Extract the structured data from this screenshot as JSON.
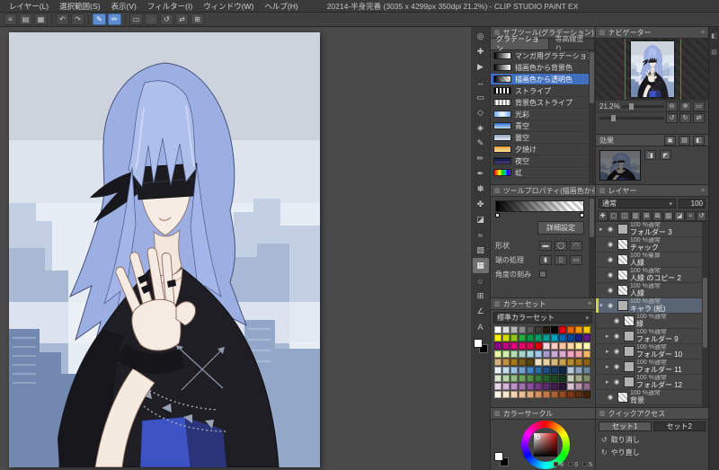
{
  "window": {
    "title": "20214-半身完番 (3035 x 4299px 350dpi 21.2%) - CLIP STUDIO PAINT EX",
    "menus": [
      "レイヤー(L)",
      "選択範囲(S)",
      "表示(V)",
      "フィルター(I)",
      "ウィンドウ(W)",
      "ヘルプ(H)"
    ]
  },
  "toolbar": {
    "buttons": [
      {
        "name": "main-menu-button",
        "glyph": "≡",
        "active": false
      },
      {
        "name": "new-canvas-button",
        "glyph": "▤",
        "active": false
      },
      {
        "name": "save-button",
        "glyph": "▦",
        "active": false
      },
      {
        "name": "undo-button",
        "glyph": "↶",
        "active": false
      },
      {
        "name": "redo-button",
        "glyph": "↷",
        "active": false
      },
      {
        "name": "snap-ruler-toggle",
        "glyph": "✎",
        "active": true
      },
      {
        "name": "snap-guide-toggle",
        "glyph": "✏",
        "active": true
      },
      {
        "name": "select-button",
        "glyph": "▭",
        "active": false
      },
      {
        "name": "deselect-button",
        "glyph": "◌",
        "active": false
      },
      {
        "name": "rotate-view-button",
        "glyph": "↺",
        "active": false
      },
      {
        "name": "flip-view-button",
        "glyph": "⇄",
        "active": false
      },
      {
        "name": "grid-button",
        "glyph": "⊞",
        "active": false
      }
    ]
  },
  "toolbox": {
    "tools": [
      {
        "name": "zoom-tool",
        "glyph": "◎",
        "selected": false
      },
      {
        "name": "move-tool",
        "glyph": "✚",
        "selected": false
      },
      {
        "name": "operation-tool",
        "glyph": "▶",
        "selected": false
      },
      {
        "name": "layer-move-tool",
        "glyph": "↔",
        "selected": false
      },
      {
        "name": "selection-tool",
        "glyph": "▭",
        "selected": false
      },
      {
        "name": "auto-select-tool",
        "glyph": "◇",
        "selected": false
      },
      {
        "name": "eyedropper-tool",
        "glyph": "◈",
        "selected": false
      },
      {
        "name": "pen-tool",
        "glyph": "✎",
        "selected": false
      },
      {
        "name": "pencil-tool",
        "glyph": "✏",
        "selected": false
      },
      {
        "name": "brush-tool",
        "glyph": "✒",
        "selected": false
      },
      {
        "name": "airbrush-tool",
        "glyph": "✽",
        "selected": false
      },
      {
        "name": "decoration-tool",
        "glyph": "✤",
        "selected": false
      },
      {
        "name": "eraser-tool",
        "glyph": "◪",
        "selected": false
      },
      {
        "name": "blend-tool",
        "glyph": "≈",
        "selected": false
      },
      {
        "name": "fill-tool",
        "glyph": "▧",
        "selected": false
      },
      {
        "name": "gradient-tool",
        "glyph": "▦",
        "selected": true
      },
      {
        "name": "figure-tool",
        "glyph": "○",
        "selected": false
      },
      {
        "name": "frame-border-tool",
        "glyph": "⊞",
        "selected": false
      },
      {
        "name": "ruler-tool",
        "glyph": "∠",
        "selected": false
      },
      {
        "name": "text-tool",
        "glyph": "A",
        "selected": false
      }
    ],
    "foreground_color": "#ffffff",
    "background_color": "#000000"
  },
  "subtool": {
    "title": "サブツール(グラデーション)",
    "tabs": [
      "グラデーション",
      "等高線塗り"
    ],
    "items": [
      {
        "label": "マンガ用グラデーション",
        "icon": "manga-gradient",
        "selected": false
      },
      {
        "label": "描画色から背景色",
        "icon": "fg-to-bg",
        "selected": false
      },
      {
        "label": "描画色から透明色",
        "icon": "fg-to-transparent",
        "selected": true
      },
      {
        "label": "ストライプ",
        "icon": "stripe",
        "selected": false
      },
      {
        "label": "背景色ストライプ",
        "icon": "bg-stripe",
        "selected": false
      },
      {
        "label": "光彩",
        "icon": "glow",
        "selected": false
      },
      {
        "label": "青空",
        "icon": "blue-sky",
        "selected": false
      },
      {
        "label": "曇空",
        "icon": "cloudy-sky",
        "selected": false
      },
      {
        "label": "夕焼け",
        "icon": "sunset",
        "selected": false
      },
      {
        "label": "夜空",
        "icon": "night-sky",
        "selected": false
      },
      {
        "label": "虹",
        "icon": "rainbow",
        "selected": false
      }
    ]
  },
  "tool_property": {
    "title": "ツールプロパティ(描画色から透明色)",
    "detail_button": "詳細設定",
    "rows": [
      {
        "label": "形状",
        "type": "icons",
        "icons": [
          "▬",
          "◯",
          "◠"
        ]
      },
      {
        "label": "端の処理",
        "type": "icons",
        "icons": [
          "▮",
          "▯",
          "▭"
        ]
      },
      {
        "label": "角度の刻み",
        "type": "checkbox"
      }
    ]
  },
  "color_set": {
    "title": "カラーセット",
    "dropdown": "標準カラーセット",
    "colors": [
      "#ffffff",
      "#dcdddd",
      "#b5b5b6",
      "#898989",
      "#595757",
      "#3e3a39",
      "#231815",
      "#000000",
      "#e60012",
      "#eb6100",
      "#f39800",
      "#fcc800",
      "#fff100",
      "#cfdb00",
      "#8fc31f",
      "#22ac38",
      "#009944",
      "#009b6b",
      "#009e96",
      "#00a0c1",
      "#0068b7",
      "#00479d",
      "#1d2088",
      "#601986",
      "#920783",
      "#be0081",
      "#e4007f",
      "#e5006a",
      "#e5004f",
      "#d7000f",
      "#ffd3d8",
      "#ffcabf",
      "#ffc6a0",
      "#ffd8a0",
      "#ffec9f",
      "#fff9b1",
      "#e9f5a1",
      "#d1edab",
      "#b3dbb1",
      "#a5d4cb",
      "#a3d6dd",
      "#a0c7e4",
      "#a59aca",
      "#c9a8d4",
      "#dfa8cd",
      "#f0a3bd",
      "#f5a3a5",
      "#f8b862",
      "#d3b17d",
      "#c39143",
      "#a6761b",
      "#7e5c12",
      "#5a430f",
      "#efe2c2",
      "#e6d3a1",
      "#d9bb77",
      "#c9a24d",
      "#b98a2e",
      "#a5761c",
      "#8c6215",
      "#e8f1f8",
      "#c5dcee",
      "#9cc1e0",
      "#6fa3cf",
      "#4585bd",
      "#2d6aa8",
      "#1f4f87",
      "#163a66",
      "#0f2747",
      "#b5c6d6",
      "#8fa6bb",
      "#6b8599",
      "#d9e8d0",
      "#b8d4a8",
      "#93bd80",
      "#6fa65c",
      "#509048",
      "#357a35",
      "#256428",
      "#194d20",
      "#113718",
      "#c7cdb8",
      "#a3ad8c",
      "#7f8d63",
      "#ead9ec",
      "#d4b6da",
      "#bd92c7",
      "#a56fb2",
      "#8d4f9e",
      "#743a86",
      "#5b2a6b",
      "#431d52",
      "#2e1238",
      "#d8c2cf",
      "#b694ad",
      "#93688a",
      "#fdf3e7",
      "#f9e4cf",
      "#f3d2b3",
      "#ebbd95",
      "#e0a77a",
      "#d28f60",
      "#c17748",
      "#ad6034",
      "#96491f",
      "#7a3a16",
      "#5e2c10",
      "#452008"
    ]
  },
  "color_circle": {
    "title": "カラーサークル",
    "values": [
      "8",
      "0",
      "5"
    ]
  },
  "navigator": {
    "title": "ナビゲーター",
    "zoom": "21.2%"
  },
  "layer_property": {
    "label": "効果"
  },
  "layers": {
    "title": "レイヤー",
    "blend_mode": "通常",
    "opacity": "100",
    "rows": [
      {
        "type": "folder",
        "blend": "100 %通常",
        "name": "フォルダー 3",
        "selected": false,
        "indent": 0
      },
      {
        "type": "layer",
        "blend": "100 %通常",
        "name": "チャック",
        "selected": false,
        "indent": 0
      },
      {
        "type": "layer",
        "blend": "100 %乗算",
        "name": "人縁",
        "selected": false,
        "indent": 0
      },
      {
        "type": "layer",
        "blend": "100 %通常",
        "name": "人縁 のコピー 2",
        "selected": false,
        "indent": 0
      },
      {
        "type": "layer",
        "blend": "100 %通常",
        "name": "人縁",
        "selected": false,
        "indent": 0
      },
      {
        "type": "folder",
        "blend": "100 %通常",
        "name": "キャラ (紙)",
        "selected": true,
        "indent": 0
      },
      {
        "type": "layer",
        "blend": "100 %通常",
        "name": "縁",
        "selected": false,
        "indent": 1
      },
      {
        "type": "folder",
        "blend": "100 %通常",
        "name": "フォルダー 9",
        "selected": false,
        "indent": 1
      },
      {
        "type": "folder",
        "blend": "100 %通常",
        "name": "フォルダー 10",
        "selected": false,
        "indent": 1
      },
      {
        "type": "folder",
        "blend": "100 %通常",
        "name": "フォルダー 11",
        "selected": false,
        "indent": 1
      },
      {
        "type": "folder",
        "blend": "100 %通常",
        "name": "フォルダー 12",
        "selected": false,
        "indent": 1
      },
      {
        "type": "layer",
        "blend": "100 %通常",
        "name": "背景",
        "selected": false,
        "indent": 0
      }
    ]
  },
  "quick_access": {
    "title": "クイックアクセス",
    "tabs": [
      "セット1",
      "セット2"
    ],
    "items": [
      {
        "glyph": "↺",
        "label": "取り消し",
        "name": "undo"
      },
      {
        "glyph": "↻",
        "label": "やり直し",
        "name": "redo"
      }
    ]
  },
  "colors": {
    "accent_selection": "#3f6fbe",
    "active_toggle": "#5f8fd0",
    "layer_marker": "#c9d64a",
    "guide_red": "#d64545",
    "hair_blue": "#9cafe2",
    "inner_garment_blue": "#3d53c4"
  }
}
